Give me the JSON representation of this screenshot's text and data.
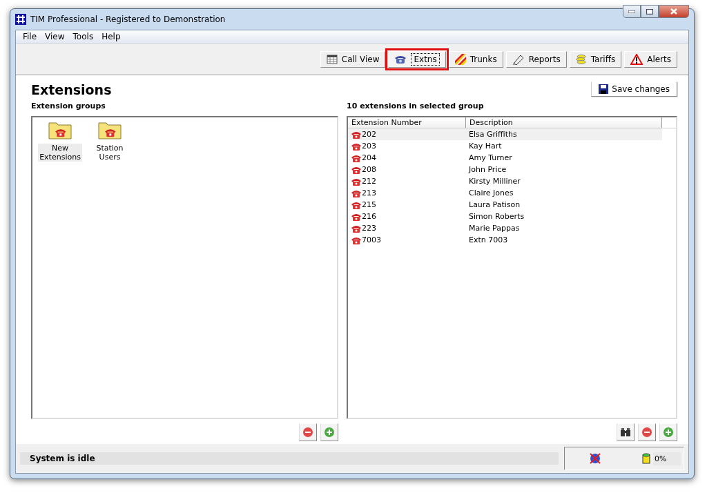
{
  "window": {
    "title": "TIM Professional - Registered to Demonstration"
  },
  "menu": [
    "File",
    "View",
    "Tools",
    "Help"
  ],
  "toolbar": [
    {
      "label": "Call View",
      "kind": "grid",
      "selected": false
    },
    {
      "label": "Extns",
      "kind": "phone",
      "selected": true
    },
    {
      "label": "Trunks",
      "kind": "stripes",
      "selected": false
    },
    {
      "label": "Reports",
      "kind": "pen",
      "selected": false
    },
    {
      "label": "Tariffs",
      "kind": "coins",
      "selected": false
    },
    {
      "label": "Alerts",
      "kind": "warning",
      "selected": false
    }
  ],
  "page": {
    "title": "Extensions",
    "save_button": "Save changes"
  },
  "groups": {
    "heading": "Extension groups",
    "items": [
      {
        "label": "New Extensions",
        "selected": true
      },
      {
        "label": "Station Users",
        "selected": false
      }
    ]
  },
  "table": {
    "heading": "10 extensions in selected group",
    "columns": [
      "Extension Number",
      "Description"
    ],
    "rows": [
      {
        "number": "202",
        "description": "Elsa Griffiths",
        "selected": true
      },
      {
        "number": "203",
        "description": "Kay Hart",
        "selected": false
      },
      {
        "number": "204",
        "description": "Amy Turner",
        "selected": false
      },
      {
        "number": "208",
        "description": "John Price",
        "selected": false
      },
      {
        "number": "212",
        "description": "Kirsty Milliner",
        "selected": false
      },
      {
        "number": "213",
        "description": "Claire Jones",
        "selected": false
      },
      {
        "number": "215",
        "description": "Laura Patison",
        "selected": false
      },
      {
        "number": "216",
        "description": "Simon Roberts",
        "selected": false
      },
      {
        "number": "223",
        "description": "Marie Pappas",
        "selected": false
      },
      {
        "number": "7003",
        "description": "Extn 7003",
        "selected": false
      }
    ]
  },
  "status_bar": {
    "message": "System is idle",
    "usage": "0%"
  }
}
